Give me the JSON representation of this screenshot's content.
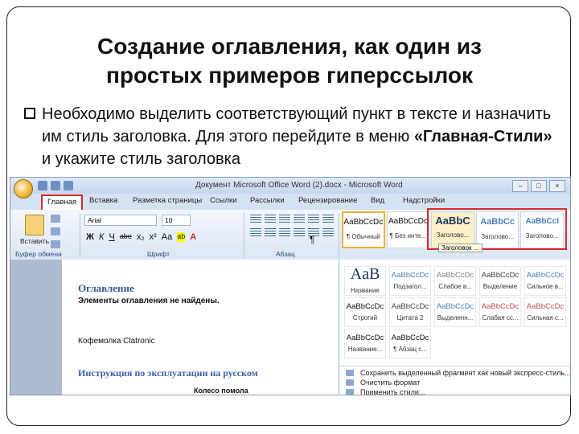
{
  "slide": {
    "title_line1": "Создание оглавления, как один из",
    "title_line2": "простых примеров гиперссылок",
    "bullet_part1": "Необходимо выделить соответствующий пункт в тексте и назначить им стиль заголовка. Для этого перейдите в меню ",
    "bullet_bold": "«Главная-Стили»",
    "bullet_part2": " и укажите стиль заголовка"
  },
  "word": {
    "window_title": "Документ Microsoft Office Word (2).docx - Microsoft Word",
    "tabs": [
      "Главная",
      "Вставка",
      "Разметка страницы",
      "Ссылки",
      "Рассылки",
      "Рецензирование",
      "Вид",
      "Надстройки"
    ],
    "active_tab": "Главная",
    "clipboard": {
      "paste_label": "Вставить",
      "group_label": "Буфер обмена"
    },
    "font": {
      "name": "Arial",
      "size": "10",
      "group_label": "Шрифт",
      "format_buttons": [
        "Ж",
        "К",
        "Ч",
        "abe",
        "x₂",
        "x²",
        "Aa",
        "ab",
        "A"
      ]
    },
    "paragraph": {
      "group_label": "Абзац",
      "pilcrow": "¶"
    },
    "ribbon_styles": [
      {
        "sample": "AaBbCcDc",
        "name": "¶ Обычный"
      },
      {
        "sample": "AaBbCcDc",
        "name": "¶ Без инте..."
      },
      {
        "sample": "AaBbC",
        "name": "Заголово..."
      },
      {
        "sample": "AaBbCc",
        "name": "Заголово..."
      },
      {
        "sample": "AaBbCcI",
        "name": "Заголово..."
      }
    ],
    "tooltip": "Заголовок ...",
    "gallery": [
      {
        "sample": "AaB",
        "name": "Название",
        "color": "#17365d",
        "big": true
      },
      {
        "sample": "AaBbCcDc",
        "name": "Подзагол...",
        "color": "#4f81bd"
      },
      {
        "sample": "AaBbCcDc",
        "name": "Слабое в...",
        "color": "#808080"
      },
      {
        "sample": "AaBbCcDc",
        "name": "Выделение",
        "color": "#404040"
      },
      {
        "sample": "AaBbCcDc",
        "name": "Сильное в...",
        "color": "#4f81bd"
      },
      {
        "sample": "AaBbCcDc",
        "name": "Строгий",
        "color": "#111111"
      },
      {
        "sample": "AaBbCcDc",
        "name": "Цитата 2",
        "color": "#404040"
      },
      {
        "sample": "AaBbCcDc",
        "name": "Выделенн...",
        "color": "#4f81bd"
      },
      {
        "sample": "AaBbCcDc",
        "name": "Слабая сс...",
        "color": "#c0504d"
      },
      {
        "sample": "AaBbCcDc",
        "name": "Сильная с...",
        "color": "#c0504d"
      },
      {
        "sample": "AaBbCcDc",
        "name": "Название...",
        "color": "#111111"
      },
      {
        "sample": "AaBbCcDc",
        "name": "¶ Абзац с...",
        "color": "#111111"
      }
    ],
    "gallery_menu": [
      "Сохранить выделенный фрагмент как новый экспресс-стиль...",
      "Очистить формат",
      "Применить стили..."
    ],
    "document": {
      "toc_title": "Оглавление",
      "toc_empty": "Элементы оглавления не найдены.",
      "company": "Кофемолка Clatronic",
      "instructions": "Инструкция по эксплуатации на русском",
      "section": "Колесо помола"
    }
  },
  "colors": {
    "accent_red": "#d62a2a",
    "ribbon_blue": "#d5e2f4"
  }
}
